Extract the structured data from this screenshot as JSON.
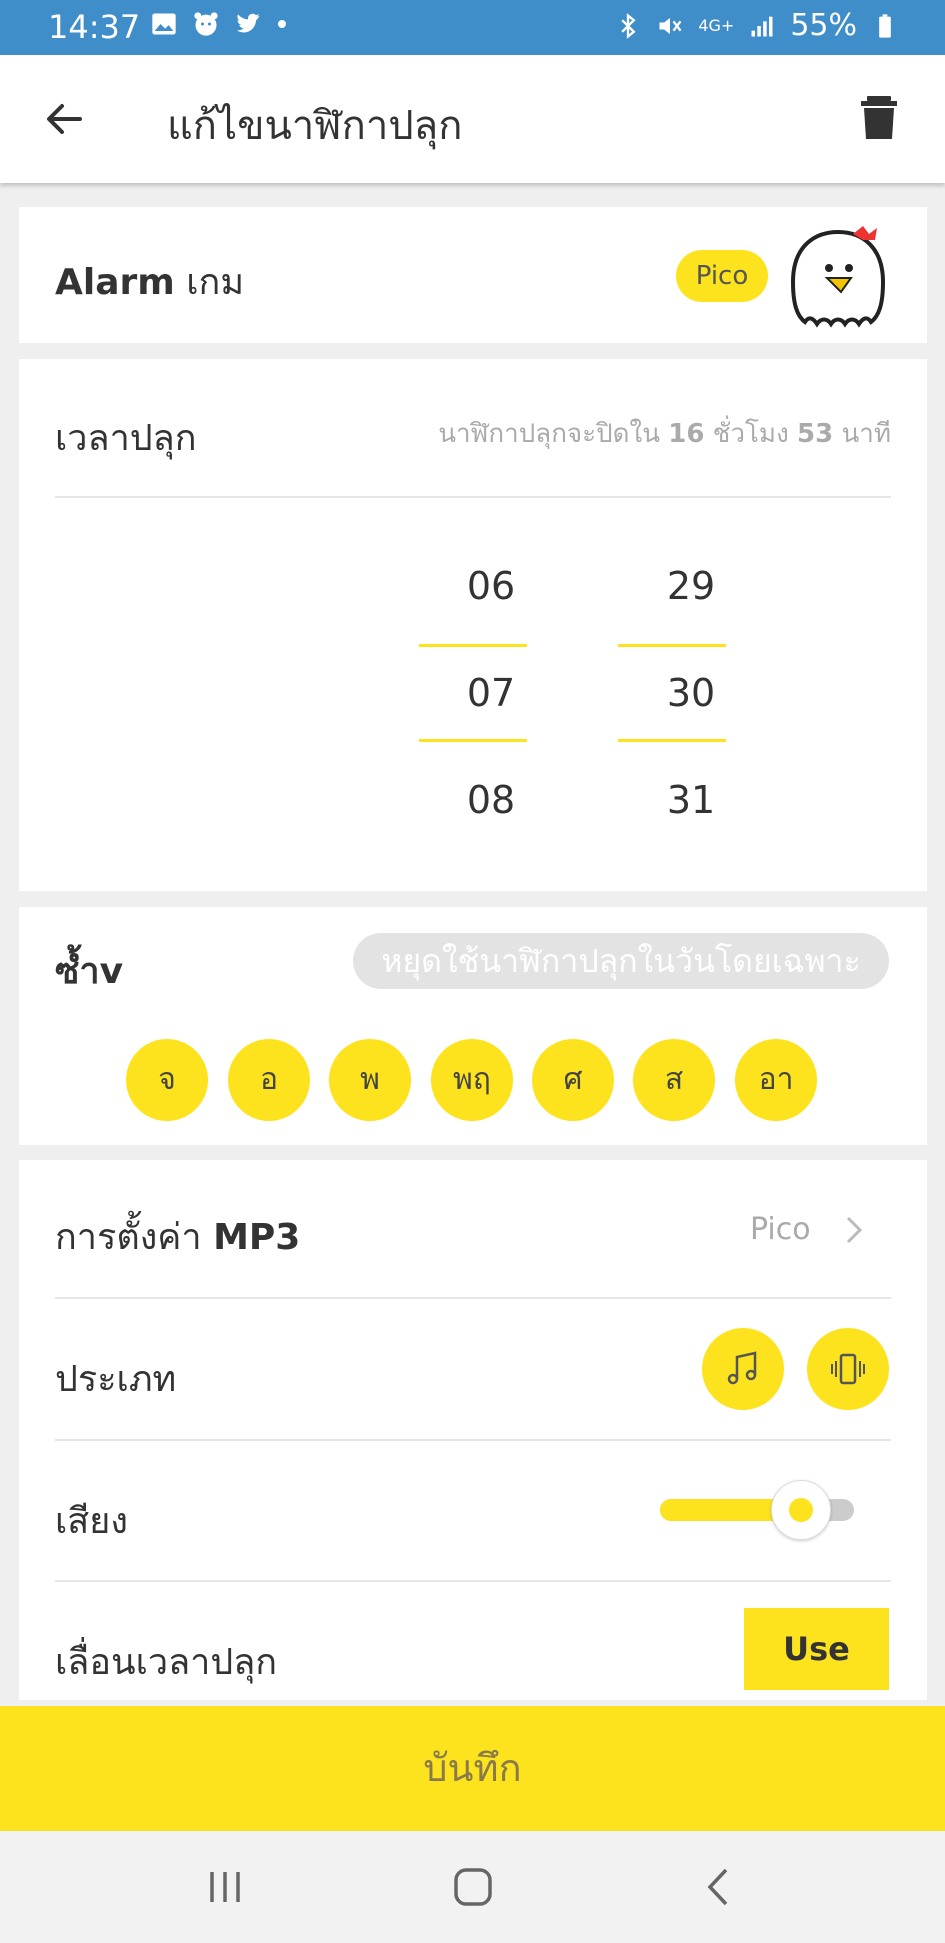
{
  "status_bar": {
    "time": "14:37",
    "battery": "55%",
    "network": "4G+",
    "left_icons": [
      "image-icon",
      "alarm-app-icon",
      "twitter-icon",
      "dot-icon"
    ],
    "right_icons": [
      "bluetooth-icon",
      "mute-icon",
      "network-4g-icon",
      "signal-icon",
      "battery-icon"
    ]
  },
  "header": {
    "title": "แก้ไขนาฬิกาปลุก"
  },
  "game_card": {
    "label_prefix": "Alarm",
    "label_suffix": "เกม",
    "badge": "Pico"
  },
  "time_card": {
    "label": "เวลาปลุก",
    "countdown_pre": "นาฬิกาปลุกจะปิดใน",
    "hours": "16",
    "hours_unit": "ชั่วโมง",
    "minutes": "53",
    "minutes_unit": "นาที",
    "hour_options": [
      "06",
      "07",
      "08"
    ],
    "minute_options": [
      "29",
      "30",
      "31"
    ],
    "selected_hour": "07",
    "selected_minute": "30"
  },
  "repeat_card": {
    "label": "ซ้ำv",
    "pause_pill": "หยุดใช้นาฬิกาปลุกในวันโดยเฉพาะ",
    "days": [
      "จ",
      "อ",
      "พ",
      "พฤ",
      "ศ",
      "ส",
      "อา"
    ]
  },
  "settings_card": {
    "mp3_label_prefix": "การตั้งค่า",
    "mp3_label_suffix": "MP3",
    "mp3_value": "Pico",
    "type_label": "ประเภท",
    "sound_label": "เสียง",
    "volume_level": 0.72,
    "snooze_label": "เลื่อนเวลาปลุก",
    "snooze_button": "Use"
  },
  "save_button": "บันทึก",
  "colors": {
    "status_bar": "#3f8ec9",
    "accent": "#fce31e",
    "background": "#efefef"
  }
}
